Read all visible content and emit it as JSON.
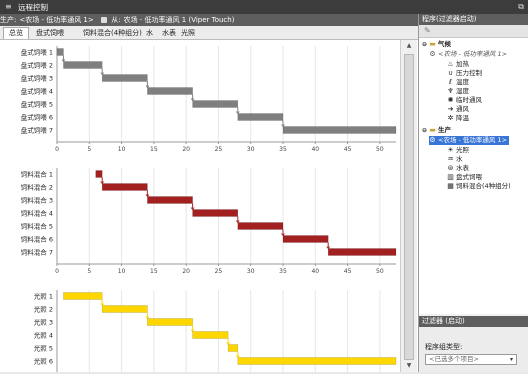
{
  "window": {
    "title": "远程控制"
  },
  "breadcrumb": {
    "prod_label": "生产:",
    "prod_value": "<农场 - 低功率通风 1>",
    "from_label": "从:",
    "from_value": "农场 - 低功率通风 1 (Viper Touch)"
  },
  "tabs": [
    "总览",
    "盘式饲喂",
    "饲料混合(4种组分)",
    "水",
    "水表",
    "光照"
  ],
  "active_tab": 0,
  "right_panel": {
    "header": "程序(过滤器启动)",
    "tree": [
      {
        "label": "气候",
        "icon": "folder-icon",
        "expand": "⊖"
      },
      {
        "label": "<农场 - 低功率通风 1>",
        "icon": "gear-icon",
        "italic": true
      },
      {
        "label": "加热",
        "icon": "flame-icon"
      },
      {
        "label": "压力控制",
        "icon": "magnet-icon"
      },
      {
        "label": "温度",
        "icon": "thermometer-icon"
      },
      {
        "label": "湿度",
        "icon": "humidity-icon"
      },
      {
        "label": "临时通风",
        "icon": "vent-icon"
      },
      {
        "label": "通风",
        "icon": "arrow-icon"
      },
      {
        "label": "降温",
        "icon": "cooling-icon"
      },
      {
        "label": "生产",
        "icon": "folder-icon",
        "expand": "⊖"
      },
      {
        "label": "<农场 - 低功率通风 1>",
        "icon": "gear-icon",
        "selected": true
      },
      {
        "label": "光照",
        "icon": "light-icon"
      },
      {
        "label": "水",
        "icon": "water-icon"
      },
      {
        "label": "水表",
        "icon": "meter-icon"
      },
      {
        "label": "盘式饲喂",
        "icon": "feed-icon"
      },
      {
        "label": "饲料混合(4种组分)",
        "icon": "mix-icon"
      }
    ],
    "filter_header": "过滤器 (启动)",
    "filter_label": "程序组类型:",
    "filter_placeholder": "<已选多个项目>"
  },
  "chart_data": [
    {
      "type": "gantt",
      "color": "#7f7f7f",
      "categories": [
        "盘式饲喂 1",
        "盘式饲喂 2",
        "盘式饲喂 3",
        "盘式饲喂 4",
        "盘式饲喂 5",
        "盘式饲喂 6",
        "盘式饲喂 7"
      ],
      "ranges": [
        [
          0,
          1
        ],
        [
          1,
          7
        ],
        [
          7,
          14
        ],
        [
          14,
          21
        ],
        [
          21,
          28
        ],
        [
          28,
          35
        ],
        [
          35,
          52.5
        ]
      ],
      "xlim": [
        0,
        52.5
      ],
      "xticks": [
        0,
        5,
        10,
        15,
        20,
        25,
        30,
        35,
        40,
        45,
        50
      ]
    },
    {
      "type": "gantt",
      "color": "#a32020",
      "categories": [
        "饲料混合 1",
        "饲料混合 2",
        "饲料混合 3",
        "饲料混合 4",
        "饲料混合 5",
        "饲料混合 6",
        "饲料混合 7"
      ],
      "ranges": [
        [
          6,
          7
        ],
        [
          7,
          14
        ],
        [
          14,
          21
        ],
        [
          21,
          28
        ],
        [
          28,
          35
        ],
        [
          35,
          42
        ],
        [
          42,
          52.5
        ]
      ],
      "xlim": [
        0,
        52.5
      ],
      "xticks": [
        0,
        5,
        10,
        15,
        20,
        25,
        30,
        35,
        40,
        45,
        50
      ]
    },
    {
      "type": "gantt",
      "color": "#ffd700",
      "categories": [
        "光照 1",
        "光照 2",
        "光照 3",
        "光照 4",
        "光照 5",
        "光照 6"
      ],
      "ranges": [
        [
          1,
          7
        ],
        [
          7,
          14
        ],
        [
          14,
          21
        ],
        [
          21,
          26.5
        ],
        [
          26.5,
          28
        ],
        [
          28,
          52.5
        ]
      ],
      "xlim": [
        0,
        52.5
      ],
      "xticks": [
        0,
        5,
        10,
        15,
        20,
        25,
        30,
        35,
        40,
        45,
        50
      ]
    }
  ]
}
